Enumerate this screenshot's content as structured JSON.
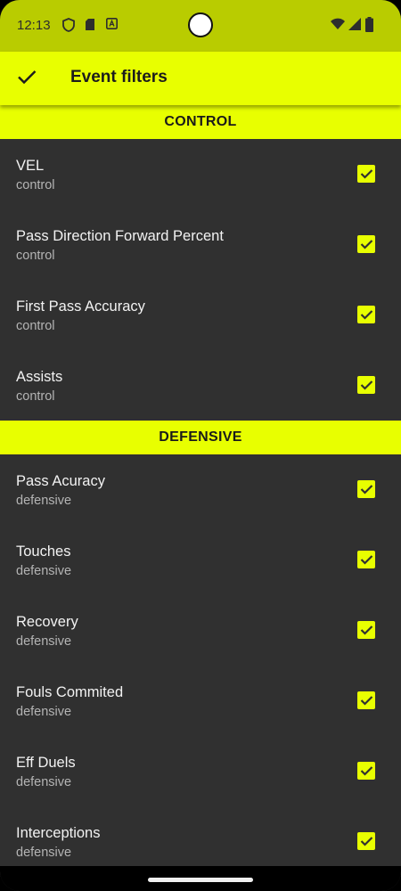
{
  "status_bar": {
    "time": "12:13",
    "left_icons": [
      "shield-icon",
      "sd-card-icon",
      "translate-icon"
    ],
    "right_icons": [
      "wifi-icon",
      "signal-icon",
      "battery-icon"
    ]
  },
  "app_bar": {
    "title": "Event filters",
    "confirm_icon": "check-icon"
  },
  "colors": {
    "accent": "#e8ff00",
    "status_bar": "#b9cc00",
    "background": "#303030"
  },
  "sections": [
    {
      "title": "CONTROL",
      "items": [
        {
          "title": "VEL",
          "subtitle": "control",
          "checked": true
        },
        {
          "title": "Pass Direction Forward Percent",
          "subtitle": "control",
          "checked": true
        },
        {
          "title": "First Pass Accuracy",
          "subtitle": "control",
          "checked": true
        },
        {
          "title": "Assists",
          "subtitle": "control",
          "checked": true
        }
      ]
    },
    {
      "title": "DEFENSIVE",
      "items": [
        {
          "title": "Pass Acuracy",
          "subtitle": "defensive",
          "checked": true
        },
        {
          "title": "Touches",
          "subtitle": "defensive",
          "checked": true
        },
        {
          "title": "Recovery",
          "subtitle": "defensive",
          "checked": true
        },
        {
          "title": "Fouls Commited",
          "subtitle": "defensive",
          "checked": true
        },
        {
          "title": "Eff Duels",
          "subtitle": "defensive",
          "checked": true
        },
        {
          "title": "Interceptions",
          "subtitle": "defensive",
          "checked": true
        }
      ]
    }
  ]
}
